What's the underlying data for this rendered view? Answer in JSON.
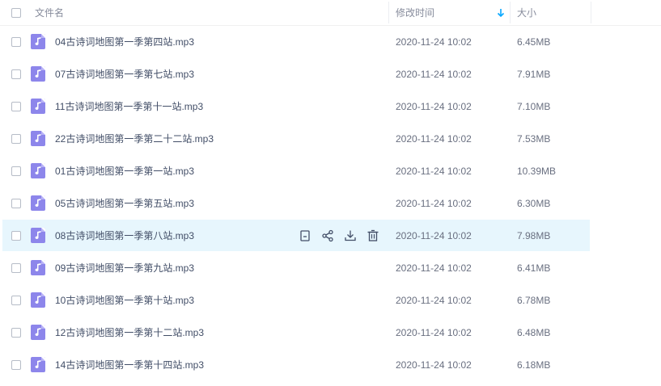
{
  "header": {
    "name_label": "文件名",
    "mtime_label": "修改时间",
    "size_label": "大小",
    "sort_indicator": "arrow-down-icon",
    "accent_color": "#06a7ff"
  },
  "files": [
    {
      "name": "04古诗词地图第一季第四站.mp3",
      "mtime": "2020-11-24 10:02",
      "size": "6.45MB"
    },
    {
      "name": "07古诗词地图第一季第七站.mp3",
      "mtime": "2020-11-24 10:02",
      "size": "7.91MB"
    },
    {
      "name": "11古诗词地图第一季第十一站.mp3",
      "mtime": "2020-11-24 10:02",
      "size": "7.10MB"
    },
    {
      "name": "22古诗词地图第一季第二十二站.mp3",
      "mtime": "2020-11-24 10:02",
      "size": "7.53MB"
    },
    {
      "name": "01古诗词地图第一季第一站.mp3",
      "mtime": "2020-11-24 10:02",
      "size": "10.39MB"
    },
    {
      "name": "05古诗词地图第一季第五站.mp3",
      "mtime": "2020-11-24 10:02",
      "size": "6.30MB"
    },
    {
      "name": "08古诗词地图第一季第八站.mp3",
      "mtime": "2020-11-24 10:02",
      "size": "7.98MB",
      "hovered": true
    },
    {
      "name": "09古诗词地图第一季第九站.mp3",
      "mtime": "2020-11-24 10:02",
      "size": "6.41MB"
    },
    {
      "name": "10古诗词地图第一季第十站.mp3",
      "mtime": "2020-11-24 10:02",
      "size": "6.78MB"
    },
    {
      "name": "12古诗词地图第一季第十二站.mp3",
      "mtime": "2020-11-24 10:02",
      "size": "6.48MB"
    },
    {
      "name": "14古诗词地图第一季第十四站.mp3",
      "mtime": "2020-11-24 10:02",
      "size": "6.18MB"
    }
  ],
  "row_actions": [
    "copy-link-icon",
    "share-icon",
    "download-icon",
    "delete-icon"
  ],
  "file_icon": "audio-file-icon",
  "icon_color": "#8d86eb",
  "hover_color": "#e7f6fd"
}
